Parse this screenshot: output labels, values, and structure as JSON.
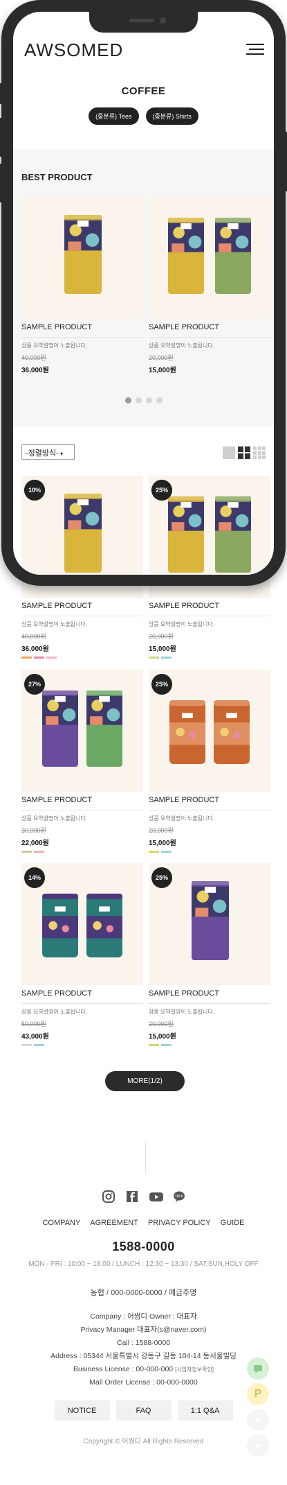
{
  "brand": {
    "logo": "AWSOMED"
  },
  "category": {
    "title": "COFFEE",
    "subcategories": [
      {
        "label": "(중분류) Tees"
      },
      {
        "label": "(중분류) Shirts"
      }
    ]
  },
  "best": {
    "title": "BEST PRODUCT",
    "products": [
      {
        "name": "SAMPLE PRODUCT",
        "desc": "상품 요약설명이 노출됩니다.",
        "price_old": "40,000원",
        "price_new": "36,000원"
      },
      {
        "name": "SAMPLE PRODUCT",
        "desc": "상품 요약설명이 노출됩니다.",
        "price_old": "20,000원",
        "price_new": "15,000원"
      }
    ],
    "slide_count": 4,
    "active_slide": 1
  },
  "listing": {
    "sort_label": "-정렬방식-",
    "view_modes": [
      "list-view-icon",
      "grid-2-icon",
      "grid-3-icon"
    ],
    "active_view": "grid-2-icon",
    "products": [
      {
        "badge": "10%",
        "name": "SAMPLE PRODUCT",
        "desc": "상품 요약설명이 노출됩니다.",
        "price_old": "40,000원",
        "price_new": "36,000원",
        "colors": [
          "#f0a35e",
          "#e88aa0",
          "#f4b3c2"
        ]
      },
      {
        "badge": "25%",
        "name": "SAMPLE PRODUCT",
        "desc": "상품 요약설명이 노출됩니다.",
        "price_old": "20,000원",
        "price_new": "15,000원",
        "colors": [
          "#c9d88a",
          "#9ccfe0"
        ]
      },
      {
        "badge": "27%",
        "name": "SAMPLE PRODUCT",
        "desc": "상품 요약설명이 노출됩니다.",
        "price_old": "30,000원",
        "price_new": "22,000원",
        "colors": [
          "#d6c5a0",
          "#e8b6b6"
        ]
      },
      {
        "badge": "25%",
        "name": "SAMPLE PRODUCT",
        "desc": "상품 요약설명이 노출됩니다.",
        "price_old": "20,000원",
        "price_new": "15,000원",
        "colors": [
          "#d9d76a",
          "#9ccfe0"
        ]
      },
      {
        "badge": "14%",
        "name": "SAMPLE PRODUCT",
        "desc": "상품 요약설명이 노출됩니다.",
        "price_old": "50,000원",
        "price_new": "43,000원",
        "colors": [
          "#ffffff",
          "#9ccfe0"
        ]
      },
      {
        "badge": "25%",
        "name": "SAMPLE PRODUCT",
        "desc": "상품 요약설명이 노출됩니다.",
        "price_old": "20,000원",
        "price_new": "15,000원",
        "colors": [
          "#d9d76a",
          "#9ccfe0"
        ]
      }
    ],
    "more_label": "MORE(1/2)"
  },
  "footer": {
    "social": [
      "instagram-icon",
      "facebook-icon",
      "youtube-icon",
      "talk-icon"
    ],
    "links": [
      "COMPANY",
      "AGREEMENT",
      "PRIVACY POLICY",
      "GUIDE"
    ],
    "phone": "1588-0000",
    "hours": "MON - FRI : 10:00 ~ 18:00 / LUNCH : 12:30 ~ 13:30 / SAT,SUN,HOLY OFF",
    "bank": "농협 / 000-0000-0000 / 예금주명",
    "company": "Company : 어썸디   Owner : 대표자",
    "privacy_manager": "Privacy Manager 대표자(",
    "privacy_email": "s@naver.com",
    "privacy_close": ")",
    "call": "Call : 1588-0000",
    "address": "Address : 05344 서울특별시 강동구 길동 104-14 동서울빌딩",
    "business_license": "Business License : 00-000-000",
    "business_info_link": "[사업자정보확인]",
    "mall_license": "Mall Order License : 00-000-0000",
    "buttons": [
      "NOTICE",
      "FAQ",
      "1:1 Q&A"
    ],
    "copyright": "Copyright © 어썸디 All Rights Reserved"
  },
  "colors": {
    "dark": "#222222",
    "product_bg": "#faf4ec",
    "best_bg": "#f6f6f6"
  }
}
